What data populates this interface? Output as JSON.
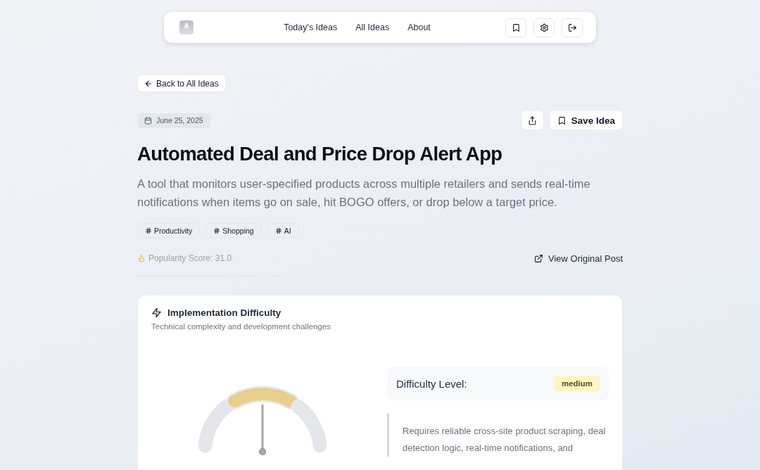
{
  "nav": {
    "links": [
      {
        "label": "Today's Ideas"
      },
      {
        "label": "All Ideas"
      },
      {
        "label": "About"
      }
    ]
  },
  "back_link": {
    "label": "Back to All Ideas"
  },
  "idea": {
    "date": "June 25, 2025",
    "save_label": "Save Idea",
    "title": "Automated Deal and Price Drop Alert App",
    "description": "A tool that monitors user-specified products across multiple retailers and sends real-time notifications when items go on sale, hit BOGO offers, or drop below a target price.",
    "tags": [
      "Productivity",
      "Shopping",
      "AI"
    ],
    "popularity": "Popularity Score: 31.0",
    "original_post_link": "View Original Post"
  },
  "difficulty_card": {
    "title": "Implementation Difficulty",
    "subtitle": "Technical complexity and development challenges",
    "gauge": {
      "level": 0.5
    },
    "level_label": "Difficulty Level:",
    "level_value": "medium",
    "explanation": "Requires reliable cross-site product scraping, deal detection logic, real-time notifications, and"
  }
}
